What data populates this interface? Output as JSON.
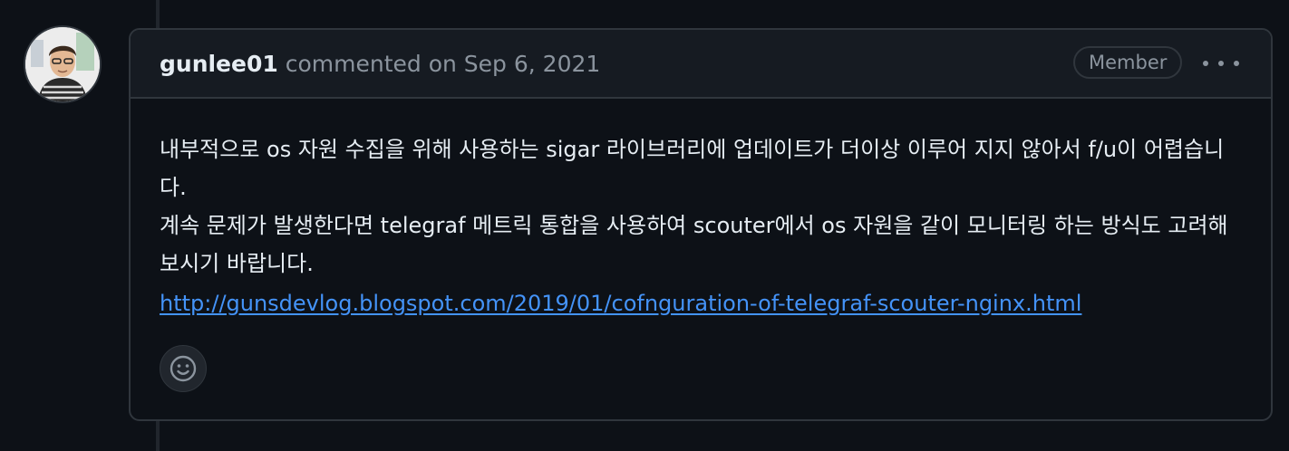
{
  "comment": {
    "author": "gunlee01",
    "action": "commented on",
    "timestamp": "Sep 6, 2021",
    "role_badge": "Member",
    "body_paragraph_1": "내부적으로 os 자원 수집을 위해 사용하는 sigar 라이브러리에 업데이트가 더이상 이루어 지지 않아서 f/u이 어렵습니다.",
    "body_paragraph_2": "계속 문제가 발생한다면 telegraf 메트릭 통합을 사용하여 scouter에서 os 자원을 같이 모니터링 하는 방식도 고려해보시기 바랍니다.",
    "link": "http://gunsdevlog.blogspot.com/2019/01/cofnguration-of-telegraf-scouter-nginx.html"
  },
  "icons": {
    "avatar": "user-avatar",
    "menu": "kebab-horizontal-icon",
    "reaction": "smiley-icon"
  },
  "colors": {
    "background": "#0d1117",
    "header_background": "#161b22",
    "border": "#30363d",
    "text_primary": "#e6edf3",
    "text_muted": "#8b949e",
    "link": "#4493f8"
  }
}
